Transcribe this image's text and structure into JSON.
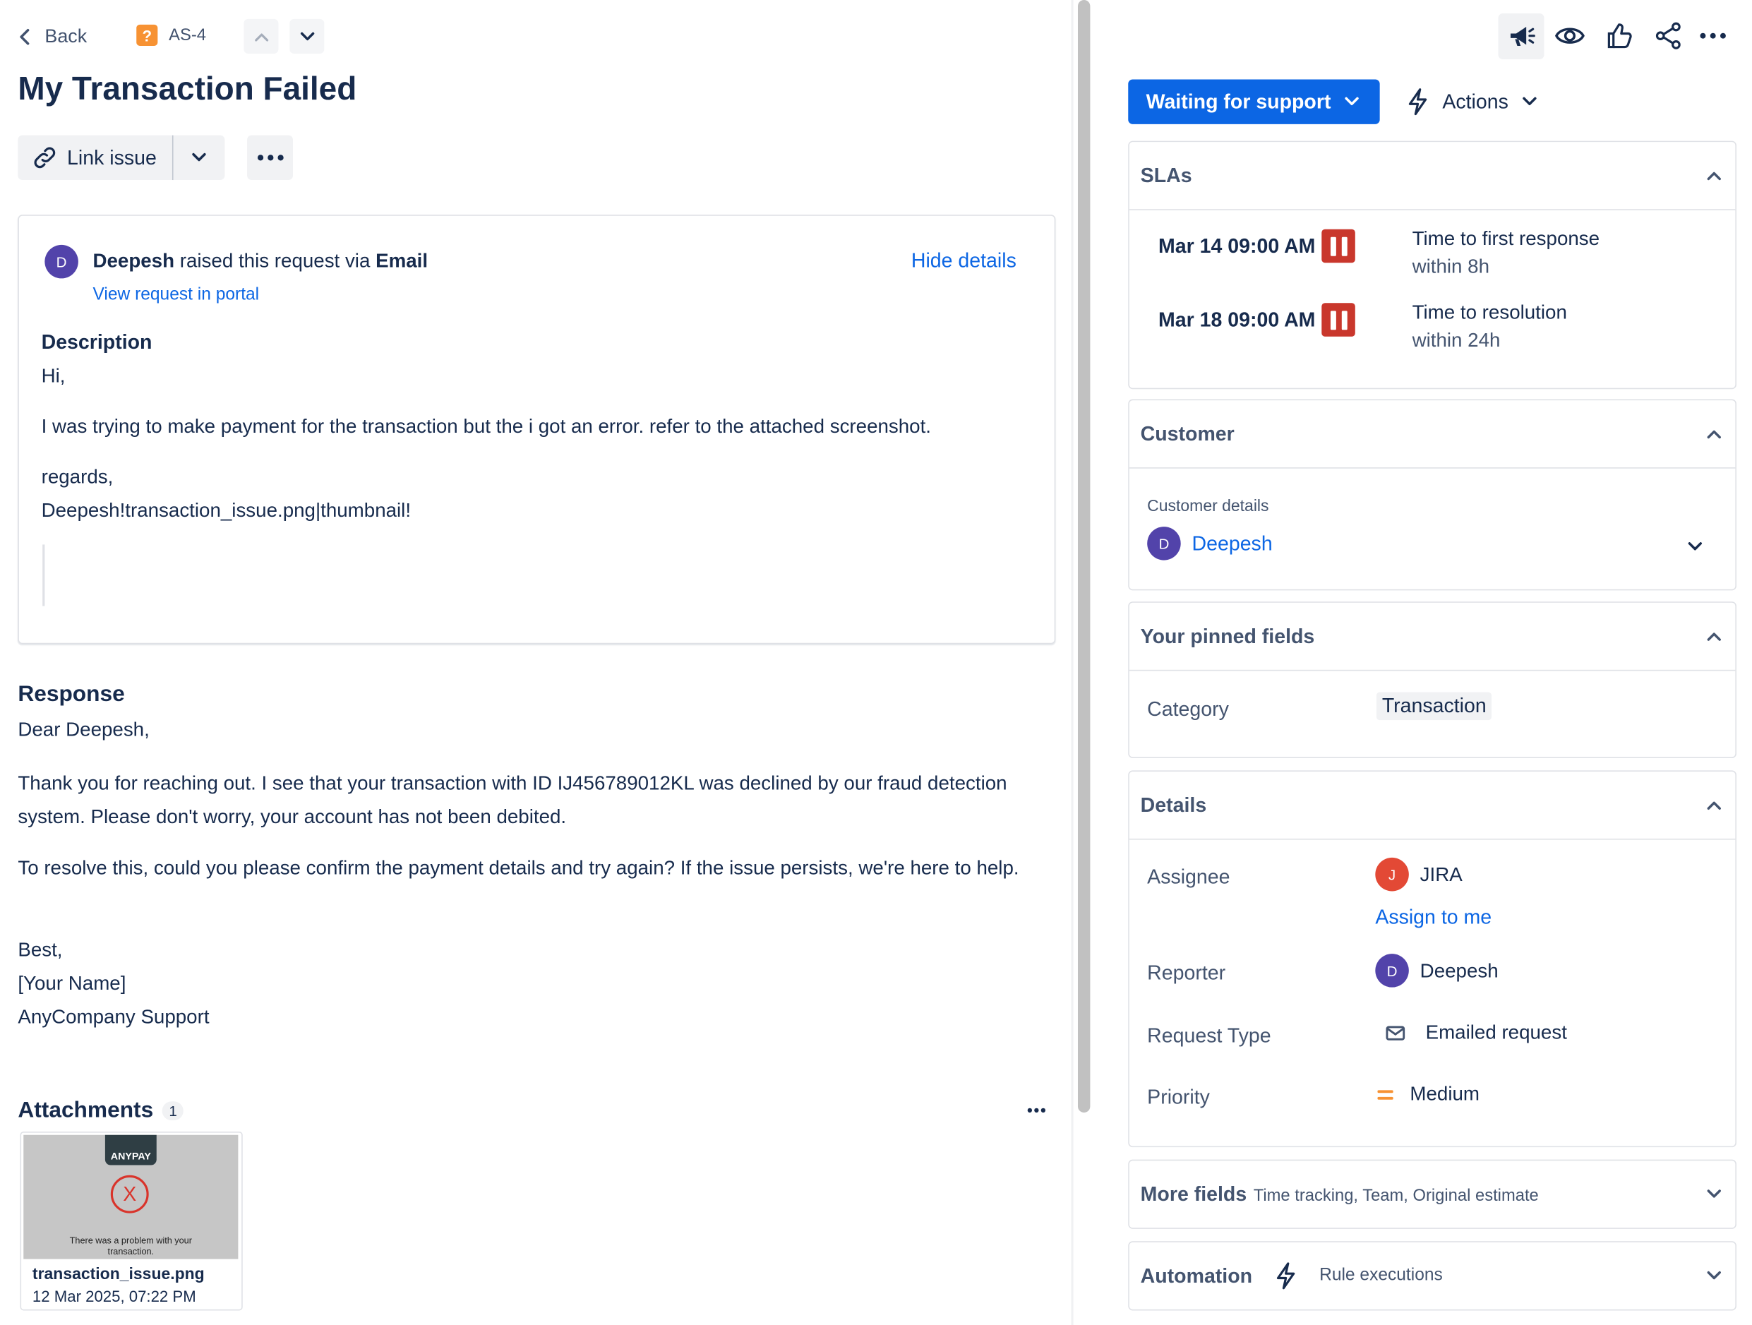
{
  "header": {
    "back_label": "Back",
    "issue_key": "AS-4",
    "issue_type_icon": "question-mark-icon",
    "title": "My Transaction Failed",
    "link_issue_label": "Link issue"
  },
  "request": {
    "reporter_initial": "D",
    "reporter_name": "Deepesh",
    "raised_text": "raised this request via",
    "channel": "Email",
    "hide_details": "Hide details",
    "view_portal": "View request in portal",
    "description_heading": "Description",
    "description_lines": [
      "Hi,",
      "I was trying to make payment for the transaction but the i got an error. refer to the attached screenshot.",
      "regards,",
      "Deepesh!transaction_issue.png|thumbnail!"
    ]
  },
  "response": {
    "heading": "Response",
    "greeting": "Dear Deepesh,",
    "para1": "Thank you for reaching out. I see that your transaction with ID IJ456789012KL was declined by our fraud detection system. Please don't worry, your account has not been debited.",
    "para2": "To resolve this, could you please confirm the payment details and try again? If the issue persists, we're here to help.",
    "signoff": "Best,",
    "name": "[Your Name]",
    "company": "AnyCompany Support"
  },
  "attachments": {
    "heading": "Attachments",
    "count": "1",
    "file": {
      "brand": "ANYPAY",
      "mark": "X",
      "preview_text": "There was a problem with your transaction.",
      "name": "transaction_issue.png",
      "date": "12 Mar 2025, 07:22 PM"
    }
  },
  "sidebar": {
    "status_label": "Waiting for support",
    "actions_label": "Actions",
    "slas": {
      "heading": "SLAs",
      "items": [
        {
          "date": "Mar 14 09:00 AM",
          "name": "Time to first response",
          "target": "within 8h"
        },
        {
          "date": "Mar 18 09:00 AM",
          "name": "Time to resolution",
          "target": "within 24h"
        }
      ]
    },
    "customer": {
      "heading": "Customer",
      "sublabel": "Customer details",
      "initial": "D",
      "name": "Deepesh"
    },
    "pinned": {
      "heading": "Your pinned fields",
      "category_label": "Category",
      "category_value": "Transaction"
    },
    "details": {
      "heading": "Details",
      "assignee_label": "Assignee",
      "assignee_initial": "J",
      "assignee_name": "JIRA",
      "assign_to_me": "Assign to me",
      "reporter_label": "Reporter",
      "reporter_initial": "D",
      "reporter_name": "Deepesh",
      "request_type_label": "Request Type",
      "request_type_value": "Emailed request",
      "priority_label": "Priority",
      "priority_value": "Medium"
    },
    "more_fields": {
      "heading": "More fields",
      "sub": "Time tracking, Team, Original estimate"
    },
    "automation": {
      "heading": "Automation",
      "sub": "Rule executions"
    }
  },
  "colors": {
    "primary": "#0c66e4",
    "status_button": "#0c66e4",
    "sla_paused": "#c9372c",
    "avatar_purple": "#5243aa",
    "avatar_orange": "#e34935",
    "priority_medium": "#f79233"
  }
}
